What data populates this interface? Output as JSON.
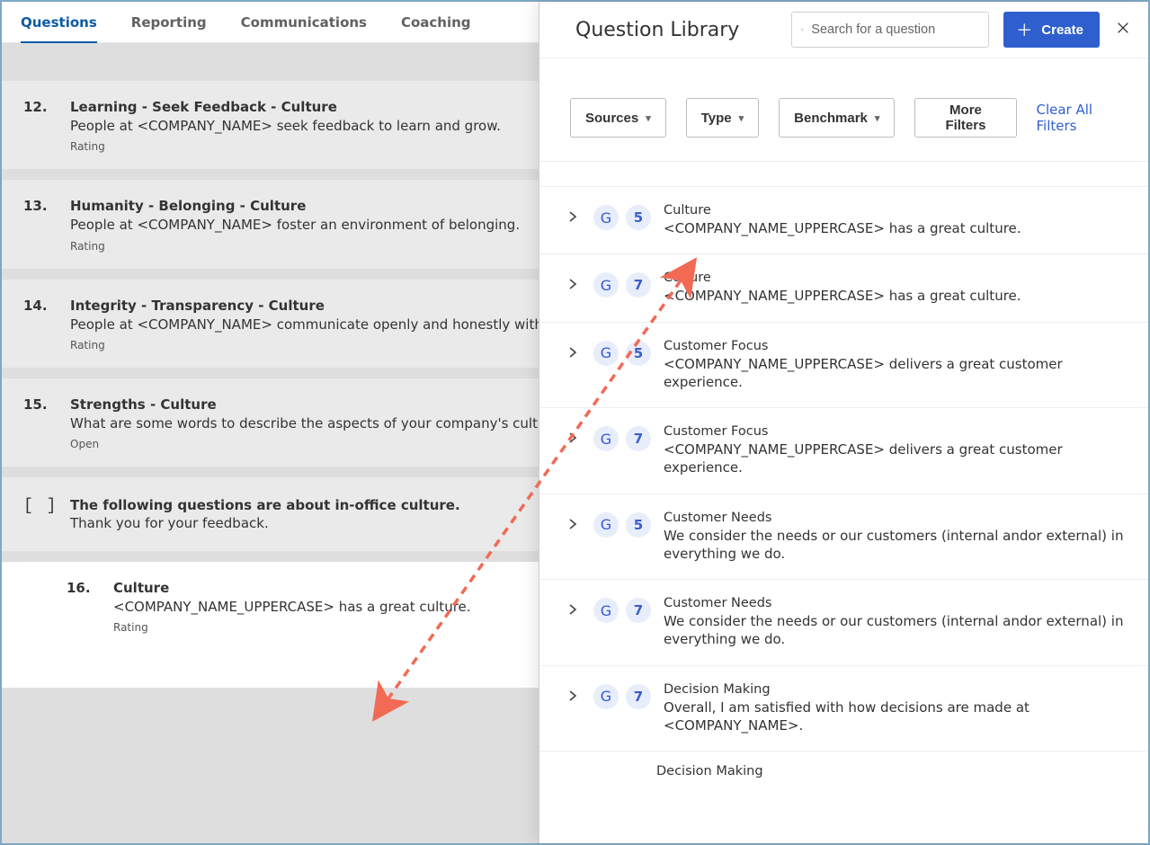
{
  "tabs": {
    "items": [
      {
        "label": "Questions",
        "active": true
      },
      {
        "label": "Reporting",
        "active": false
      },
      {
        "label": "Communications",
        "active": false
      },
      {
        "label": "Coaching",
        "active": false
      }
    ]
  },
  "questions": [
    {
      "num": "12.",
      "title": "Learning - Seek Feedback - Culture",
      "text": "People at <COMPANY_NAME> seek feedback to learn and grow.",
      "type": "Rating"
    },
    {
      "num": "13.",
      "title": "Humanity - Belonging - Culture",
      "text": "People at <COMPANY_NAME> foster an environment of belonging.",
      "type": "Rating"
    },
    {
      "num": "14.",
      "title": "Integrity - Transparency - Culture",
      "text": "People at <COMPANY_NAME> communicate openly and honestly with each other.",
      "type": "Rating"
    },
    {
      "num": "15.",
      "title": "Strengths - Culture",
      "text": "What are some words to describe the aspects of your company's culture that you see as strengths?",
      "type": "Open"
    }
  ],
  "section": {
    "icon": "[ ]",
    "title": "The following questions are about in-office culture.",
    "sub": "Thank you for your feedback."
  },
  "new_question": {
    "num": "16.",
    "title": "Culture",
    "text": "<COMPANY_NAME_UPPERCASE> has a great culture.",
    "type": "Rating"
  },
  "footer_plus": "+",
  "drawer": {
    "title": "Question Library",
    "search_placeholder": "Search for a question",
    "create_label": "Create",
    "filters": {
      "sources": "Sources",
      "type": "Type",
      "benchmark": "Benchmark",
      "more": "More Filters",
      "clear": "Clear All Filters"
    }
  },
  "library": [
    {
      "badge": "5",
      "cat": "Culture",
      "desc": "<COMPANY_NAME_UPPERCASE> has a great culture."
    },
    {
      "badge": "7",
      "cat": "Culture",
      "desc": "<COMPANY_NAME_UPPERCASE> has a great culture."
    },
    {
      "badge": "5",
      "cat": "Customer Focus",
      "desc": "<COMPANY_NAME_UPPERCASE> delivers a great customer experience."
    },
    {
      "badge": "7",
      "cat": "Customer Focus",
      "desc": "<COMPANY_NAME_UPPERCASE> delivers a great customer experience."
    },
    {
      "badge": "5",
      "cat": "Customer Needs",
      "desc": "We consider the needs or our customers (internal andor external) in everything we do."
    },
    {
      "badge": "7",
      "cat": "Customer Needs",
      "desc": "We consider the needs or our customers (internal andor external) in everything we do."
    },
    {
      "badge": "7",
      "cat": "Decision Making",
      "desc": "Overall, I am satisfied with how decisions are made at <COMPANY_NAME>."
    }
  ],
  "library_tail_cat": "Decision Making"
}
